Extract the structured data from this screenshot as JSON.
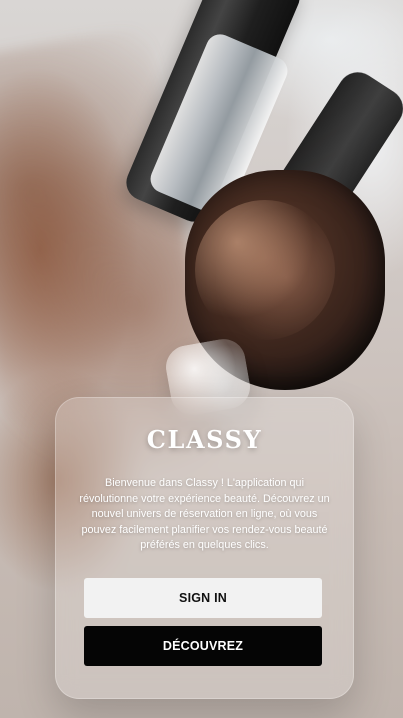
{
  "app": {
    "brand": "CLASSY",
    "description": "Bienvenue dans Classy ! L'application qui révolutionne votre expérience beauté. Découvrez un nouvel univers de réservation en ligne, où vous pouvez facilement planifier vos rendez-vous beauté préférés en quelques clics."
  },
  "actions": {
    "sign_in_label": "SIGN IN",
    "discover_label": "DÉCOUVREZ"
  },
  "colors": {
    "primary_button_bg": "#050505",
    "secondary_button_bg": "#f2f2f2",
    "text_on_dark": "#ffffff",
    "text_on_light": "#111111"
  }
}
